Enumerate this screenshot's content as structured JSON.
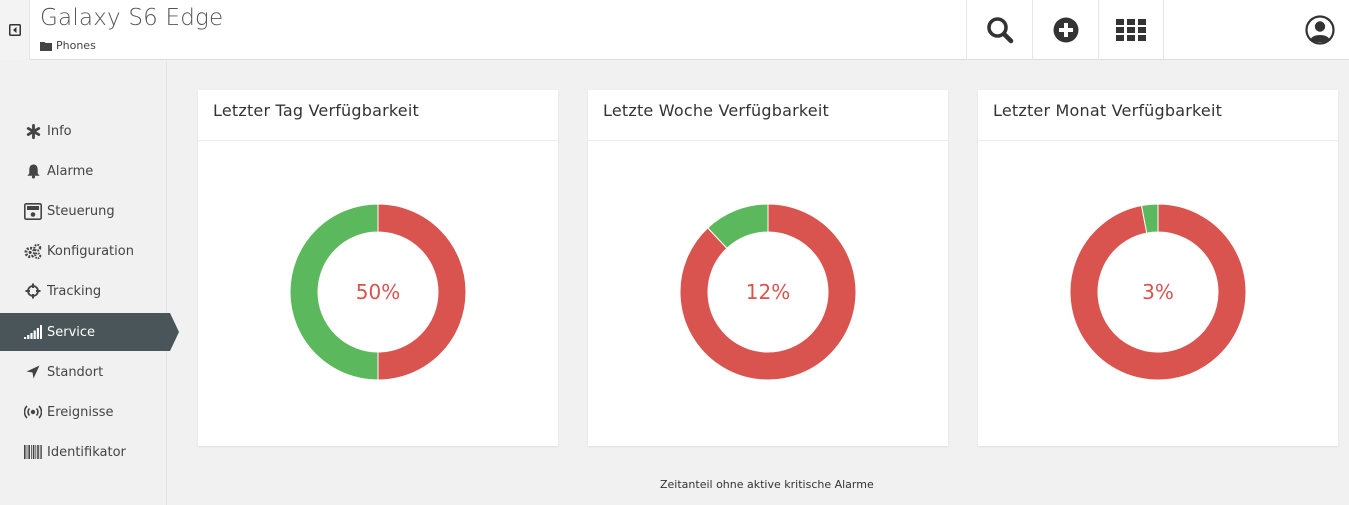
{
  "header": {
    "title": "Galaxy S6 Edge",
    "breadcrumb": "Phones",
    "buttons": {
      "toggle": "sidebar-toggle-icon",
      "search": "search-icon",
      "add": "plus-circle-icon",
      "apps": "grid-icon",
      "user": "user-circle-icon"
    }
  },
  "sidebar": {
    "items": [
      {
        "label": "Info",
        "icon": "asterisk-icon"
      },
      {
        "label": "Alarme",
        "icon": "bell-icon"
      },
      {
        "label": "Steuerung",
        "icon": "remote-icon"
      },
      {
        "label": "Konfiguration",
        "icon": "gears-icon"
      },
      {
        "label": "Tracking",
        "icon": "crosshair-icon"
      },
      {
        "label": "Service",
        "icon": "signal-icon",
        "active": true
      },
      {
        "label": "Standort",
        "icon": "location-arrow-icon"
      },
      {
        "label": "Ereignisse",
        "icon": "broadcast-icon"
      },
      {
        "label": "Identifikator",
        "icon": "barcode-icon"
      }
    ]
  },
  "colors": {
    "available": "#5cb85c",
    "unavailable": "#d9534f",
    "active_nav": "#4a5559"
  },
  "cards": [
    {
      "title": "Letzter Tag Verfügbarkeit",
      "percent_label": "50%"
    },
    {
      "title": "Letzte Woche Verfügbarkeit",
      "percent_label": "12%"
    },
    {
      "title": "Letzter Monat Verfügbarkeit",
      "percent_label": "3%"
    }
  ],
  "footnote": "Zeitanteil ohne aktive kritische Alarme",
  "chart_data": [
    {
      "type": "pie",
      "title": "Letzter Tag Verfügbarkeit",
      "categories": [
        "red",
        "green"
      ],
      "values": [
        50,
        50
      ]
    },
    {
      "type": "pie",
      "title": "Letzte Woche Verfügbarkeit",
      "categories": [
        "red",
        "green"
      ],
      "values": [
        88,
        12
      ]
    },
    {
      "type": "pie",
      "title": "Letzter Monat Verfügbarkeit",
      "categories": [
        "red",
        "green"
      ],
      "values": [
        97,
        3
      ]
    }
  ]
}
